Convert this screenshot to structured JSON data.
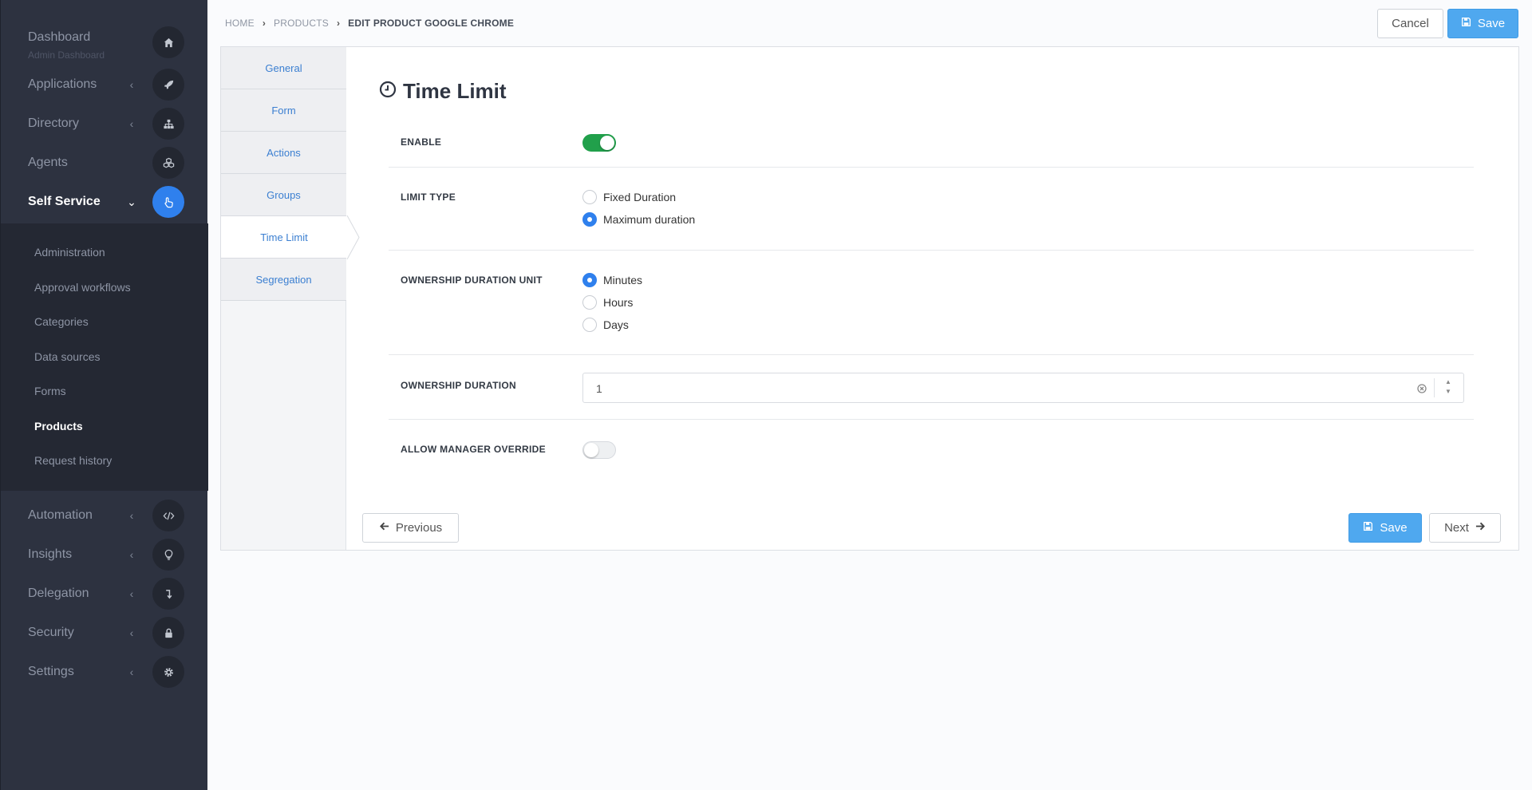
{
  "sidebar": {
    "dashboard": {
      "label": "Dashboard",
      "sub": "Admin Dashboard",
      "icon": "home-icon"
    },
    "items": [
      {
        "label": "Applications",
        "icon": "rocket-icon"
      },
      {
        "label": "Directory",
        "icon": "sitemap-icon"
      },
      {
        "label": "Agents",
        "icon": "cubes-icon"
      },
      {
        "label": "Self Service",
        "icon": "hand-pointer-icon"
      }
    ],
    "submenu": [
      {
        "label": "Administration"
      },
      {
        "label": "Approval workflows"
      },
      {
        "label": "Categories"
      },
      {
        "label": "Data sources"
      },
      {
        "label": "Forms"
      },
      {
        "label": "Products"
      },
      {
        "label": "Request history"
      }
    ],
    "bottom_items": [
      {
        "label": "Automation",
        "icon": "code-icon"
      },
      {
        "label": "Insights",
        "icon": "lightbulb-icon"
      },
      {
        "label": "Delegation",
        "icon": "level-down-icon"
      },
      {
        "label": "Security",
        "icon": "lock-icon"
      },
      {
        "label": "Settings",
        "icon": "gear-icon"
      }
    ]
  },
  "breadcrumb": {
    "home": "HOME",
    "products": "PRODUCTS",
    "current": "EDIT PRODUCT GOOGLE CHROME"
  },
  "header": {
    "cancel_label": "Cancel",
    "save_label": "Save"
  },
  "tabs": [
    {
      "label": "General"
    },
    {
      "label": "Form"
    },
    {
      "label": "Actions"
    },
    {
      "label": "Groups"
    },
    {
      "label": "Time Limit"
    },
    {
      "label": "Segregation"
    }
  ],
  "form": {
    "title": "Time Limit",
    "enable_label": "ENABLE",
    "enable_on": true,
    "limit_type_label": "LIMIT TYPE",
    "limit_type_options": [
      "Fixed Duration",
      "Maximum duration"
    ],
    "limit_type_selected": "Maximum duration",
    "unit_label": "OWNERSHIP DURATION UNIT",
    "unit_options": [
      "Minutes",
      "Hours",
      "Days"
    ],
    "unit_selected": "Minutes",
    "duration_label": "OWNERSHIP DURATION",
    "duration_value": "1",
    "override_label": "ALLOW MANAGER OVERRIDE",
    "override_on": false
  },
  "footer": {
    "previous_label": "Previous",
    "save_label": "Save",
    "next_label": "Next"
  },
  "colors": {
    "sidebar_bg": "#2d3240",
    "accent": "#2f80ed",
    "primary_button": "#4fa8ef",
    "toggle_on": "#21a04b"
  }
}
